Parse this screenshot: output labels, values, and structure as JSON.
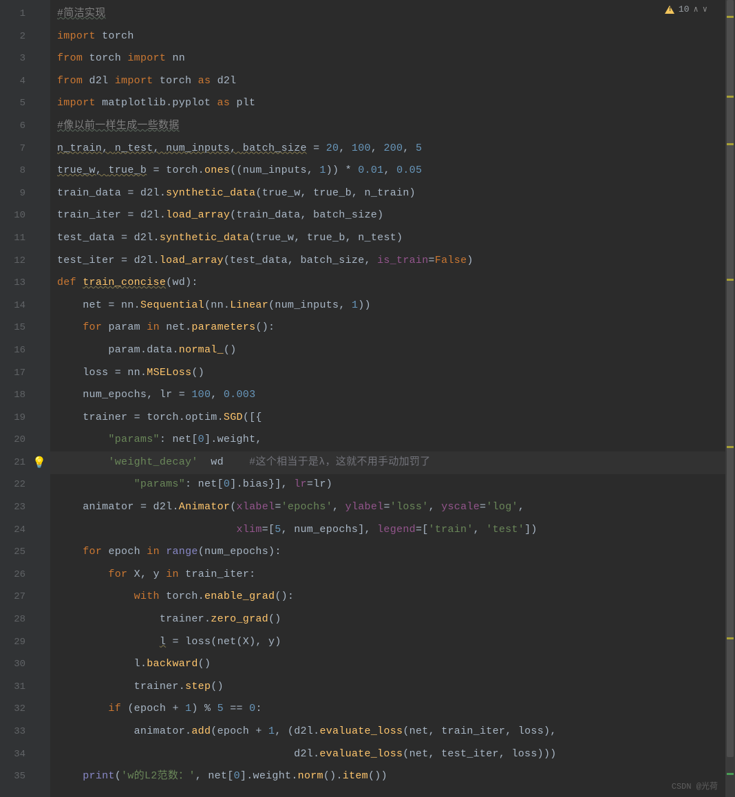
{
  "warnings": {
    "count": "10"
  },
  "watermark": "CSDN @光荷",
  "gutter": [
    "1",
    "2",
    "3",
    "4",
    "5",
    "6",
    "7",
    "8",
    "9",
    "10",
    "11",
    "12",
    "13",
    "14",
    "15",
    "16",
    "17",
    "18",
    "19",
    "20",
    "21",
    "22",
    "23",
    "24",
    "25",
    "26",
    "27",
    "28",
    "29",
    "30",
    "31",
    "32",
    "33",
    "34",
    "35"
  ],
  "code": {
    "l1": {
      "cmt": "#简洁实现"
    },
    "l2": {
      "kw1": "import",
      "id": " torch"
    },
    "l3": {
      "kw1": "from",
      "m": " torch ",
      "kw2": "import",
      "id": " nn"
    },
    "l4": {
      "kw1": "from",
      "m": " d2l ",
      "kw2": "import",
      "id": " torch ",
      "kw3": "as",
      "id2": " d2l"
    },
    "l5": {
      "kw1": "import",
      "m": " matplotlib.pyplot ",
      "kw2": "as",
      "id": " plt"
    },
    "l6": {
      "cmt": "#像以前一样生成一些数据"
    },
    "l7": {
      "a": "n_train",
      "b": "n_test",
      "c": "num_inputs",
      "d": "batch_size",
      "eq": " = ",
      "n1": "20",
      "n2": "100",
      "n3": "200",
      "n4": "5"
    },
    "l8": {
      "a": "true_w",
      "b": "true_b",
      "eq": " = ",
      "t": "torch",
      "fn": "ones",
      "p": "num_inputs",
      "n1": "1",
      "n2": "0.01",
      "n3": "0.05"
    },
    "l9": {
      "a": "train_data",
      "eq": " = ",
      "m": "d2l",
      "fn": "synthetic_data",
      "p1": "true_w",
      "p2": "true_b",
      "p3": "n_train"
    },
    "l10": {
      "a": "train_iter",
      "eq": " = ",
      "m": "d2l",
      "fn": "load_array",
      "p1": "train_data",
      "p2": "batch_size"
    },
    "l11": {
      "a": "test_data",
      "eq": " = ",
      "m": "d2l",
      "fn": "synthetic_data",
      "p1": "true_w",
      "p2": "true_b",
      "p3": "n_test"
    },
    "l12": {
      "a": "test_iter",
      "eq": " = ",
      "m": "d2l",
      "fn": "load_array",
      "p1": "test_data",
      "p2": "batch_size",
      "kw": "is_train",
      "v": "False"
    },
    "l13": {
      "kw": "def",
      "fn": "train_concise",
      "p": "wd"
    },
    "l14": {
      "a": "net",
      "eq": " = ",
      "m": "nn",
      "fn": "Sequential",
      "m2": "nn",
      "fn2": "Linear",
      "p": "num_inputs",
      "n": "1"
    },
    "l15": {
      "kw": "for",
      "v": "param",
      "kw2": "in",
      "m": "net",
      "fn": "parameters"
    },
    "l16": {
      "a": "param",
      "b": "data",
      "fn": "normal_"
    },
    "l17": {
      "a": "loss",
      "m": "nn",
      "fn": "MSELoss"
    },
    "l18": {
      "a": "num_epochs",
      "b": "lr",
      "n1": "100",
      "n2": "0.003"
    },
    "l19": {
      "a": "trainer",
      "m1": "torch",
      "m2": "optim",
      "fn": "SGD"
    },
    "l20": {
      "k": "\"params\"",
      "m": "net",
      "n": "0",
      "p": "weight"
    },
    "l21": {
      "k": "'weight_decay'",
      "p": "wd",
      "cmt": "#这个相当于是λ，这就不用手动加罚了"
    },
    "l22": {
      "k": "\"params\"",
      "m": "net",
      "n": "0",
      "p": "bias",
      "kw": "lr",
      "v": "lr"
    },
    "l23": {
      "a": "animator",
      "m": "d2l",
      "fn": "Animator",
      "k1": "xlabel",
      "v1": "'epochs'",
      "k2": "ylabel",
      "v2": "'loss'",
      "k3": "yscale",
      "v3": "'log'"
    },
    "l24": {
      "k1": "xlim",
      "n": "5",
      "v": "num_epochs",
      "k2": "legend",
      "s1": "'train'",
      "s2": "'test'"
    },
    "l25": {
      "kw": "for",
      "v": "epoch",
      "kw2": "in",
      "fn": "range",
      "p": "num_epochs"
    },
    "l26": {
      "kw": "for",
      "v1": "X",
      "v2": "y",
      "kw2": "in",
      "it": "train_iter"
    },
    "l27": {
      "kw": "with",
      "m": "torch",
      "fn": "enable_grad"
    },
    "l28": {
      "a": "trainer",
      "fn": "zero_grad"
    },
    "l29": {
      "a": "l",
      "fn": "loss",
      "p1": "net",
      "p2": "X",
      "p3": "y"
    },
    "l30": {
      "a": "l",
      "fn": "backward"
    },
    "l31": {
      "a": "trainer",
      "fn": "step"
    },
    "l32": {
      "kw": "if",
      "v": "epoch",
      "n1": "1",
      "n2": "5",
      "n3": "0"
    },
    "l33": {
      "a": "animator",
      "fn": "add",
      "v": "epoch",
      "n": "1",
      "m": "d2l",
      "fn2": "evaluate_loss",
      "p1": "net",
      "p2": "train_iter",
      "p3": "loss"
    },
    "l34": {
      "m": "d2l",
      "fn": "evaluate_loss",
      "p1": "net",
      "p2": "test_iter",
      "p3": "loss"
    },
    "l35": {
      "fn": "print",
      "s": "'w的L2范数：'",
      "m": "net",
      "n": "0",
      "p": "weight",
      "fn2": "norm",
      "fn3": "item"
    }
  }
}
